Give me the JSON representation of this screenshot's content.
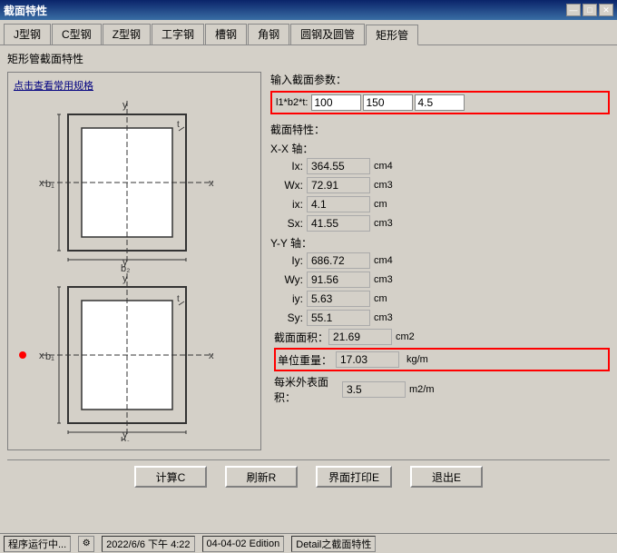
{
  "window": {
    "title": "截面特性"
  },
  "tabs": [
    {
      "label": "J型钢",
      "active": false
    },
    {
      "label": "C型钢",
      "active": false
    },
    {
      "label": "Z型钢",
      "active": false
    },
    {
      "label": "工字钢",
      "active": false
    },
    {
      "label": "槽钢",
      "active": false
    },
    {
      "label": "角钢",
      "active": false
    },
    {
      "label": "圆钢及圆管",
      "active": false
    },
    {
      "label": "矩形管",
      "active": true
    }
  ],
  "section_title": "矩形管截面特性",
  "diagram_link": "点击查看常用规格",
  "input": {
    "label": "输入截面参数：",
    "param_label": "l1*b2*t:",
    "values": [
      "100",
      "150",
      "4.5"
    ]
  },
  "properties": {
    "title": "截面特性：",
    "xx_axis": "X-X 轴：",
    "yy_axis": "Y-Y 轴：",
    "xx_props": [
      {
        "name": "Ix:",
        "value": "364.55",
        "unit": "cm4"
      },
      {
        "name": "Wx:",
        "value": "72.91",
        "unit": "cm3"
      },
      {
        "name": "ix:",
        "value": "4.1",
        "unit": "cm"
      },
      {
        "name": "Sx:",
        "value": "41.55",
        "unit": "cm3"
      }
    ],
    "yy_props": [
      {
        "name": "Iy:",
        "value": "686.72",
        "unit": "cm4"
      },
      {
        "name": "Wy:",
        "value": "91.56",
        "unit": "cm3"
      },
      {
        "name": "iy:",
        "value": "5.63",
        "unit": "cm"
      },
      {
        "name": "Sy:",
        "value": "55.1",
        "unit": "cm3"
      }
    ],
    "area": {
      "label": "截面面积：",
      "value": "21.69",
      "unit": "cm2"
    },
    "weight": {
      "label": "单位重量：",
      "value": "17.03",
      "unit": "kg/m"
    },
    "surface_area": {
      "label": "每米外表面积：",
      "value": "3.5",
      "unit": "m2/m"
    }
  },
  "buttons": {
    "calculate": "计算C",
    "refresh": "刷新R",
    "print": "界面打印E",
    "exit": "退出E"
  },
  "statusbar": {
    "running": "程序运行中...",
    "datetime": "2022/6/6  下午 4:22",
    "edition": "04-04-02 Edition",
    "detail": "Detail之截面特性"
  },
  "title_buttons": {
    "minimize": "—",
    "maximize": "□",
    "close": "✕"
  }
}
